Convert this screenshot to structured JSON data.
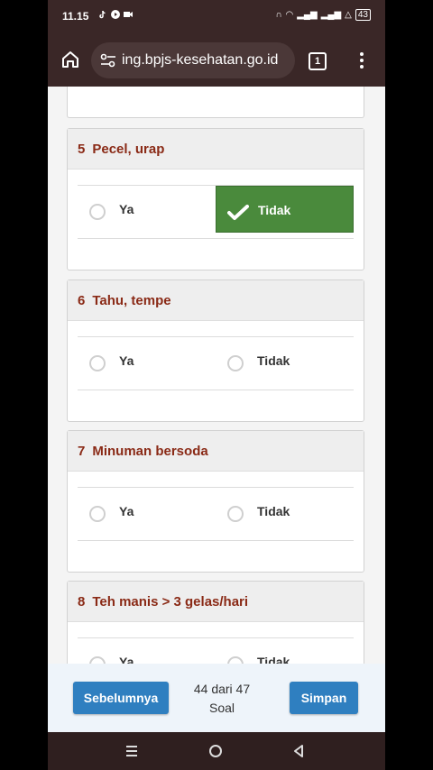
{
  "status": {
    "time": "11.15",
    "battery": "43"
  },
  "browser": {
    "url": "ing.bpjs-kesehatan.go.id",
    "tab_count": "1"
  },
  "questions": [
    {
      "number": "5",
      "text": "Pecel, urap",
      "opt_yes": "Ya",
      "opt_no": "Tidak",
      "selected": "Tidak"
    },
    {
      "number": "6",
      "text": "Tahu, tempe",
      "opt_yes": "Ya",
      "opt_no": "Tidak",
      "selected": null
    },
    {
      "number": "7",
      "text": "Minuman bersoda",
      "opt_yes": "Ya",
      "opt_no": "Tidak",
      "selected": null
    },
    {
      "number": "8",
      "text": "Teh manis > 3 gelas/hari",
      "opt_yes": "Ya",
      "opt_no": "Tidak",
      "selected": null
    }
  ],
  "footer": {
    "prev_label": "Sebelumnya",
    "progress_line1": "44 dari 47",
    "progress_line2": "Soal",
    "save_label": "Simpan"
  },
  "colors": {
    "accent": "#2f7fc0",
    "selected": "#4a8a3c",
    "question_text": "#8a2a16"
  }
}
